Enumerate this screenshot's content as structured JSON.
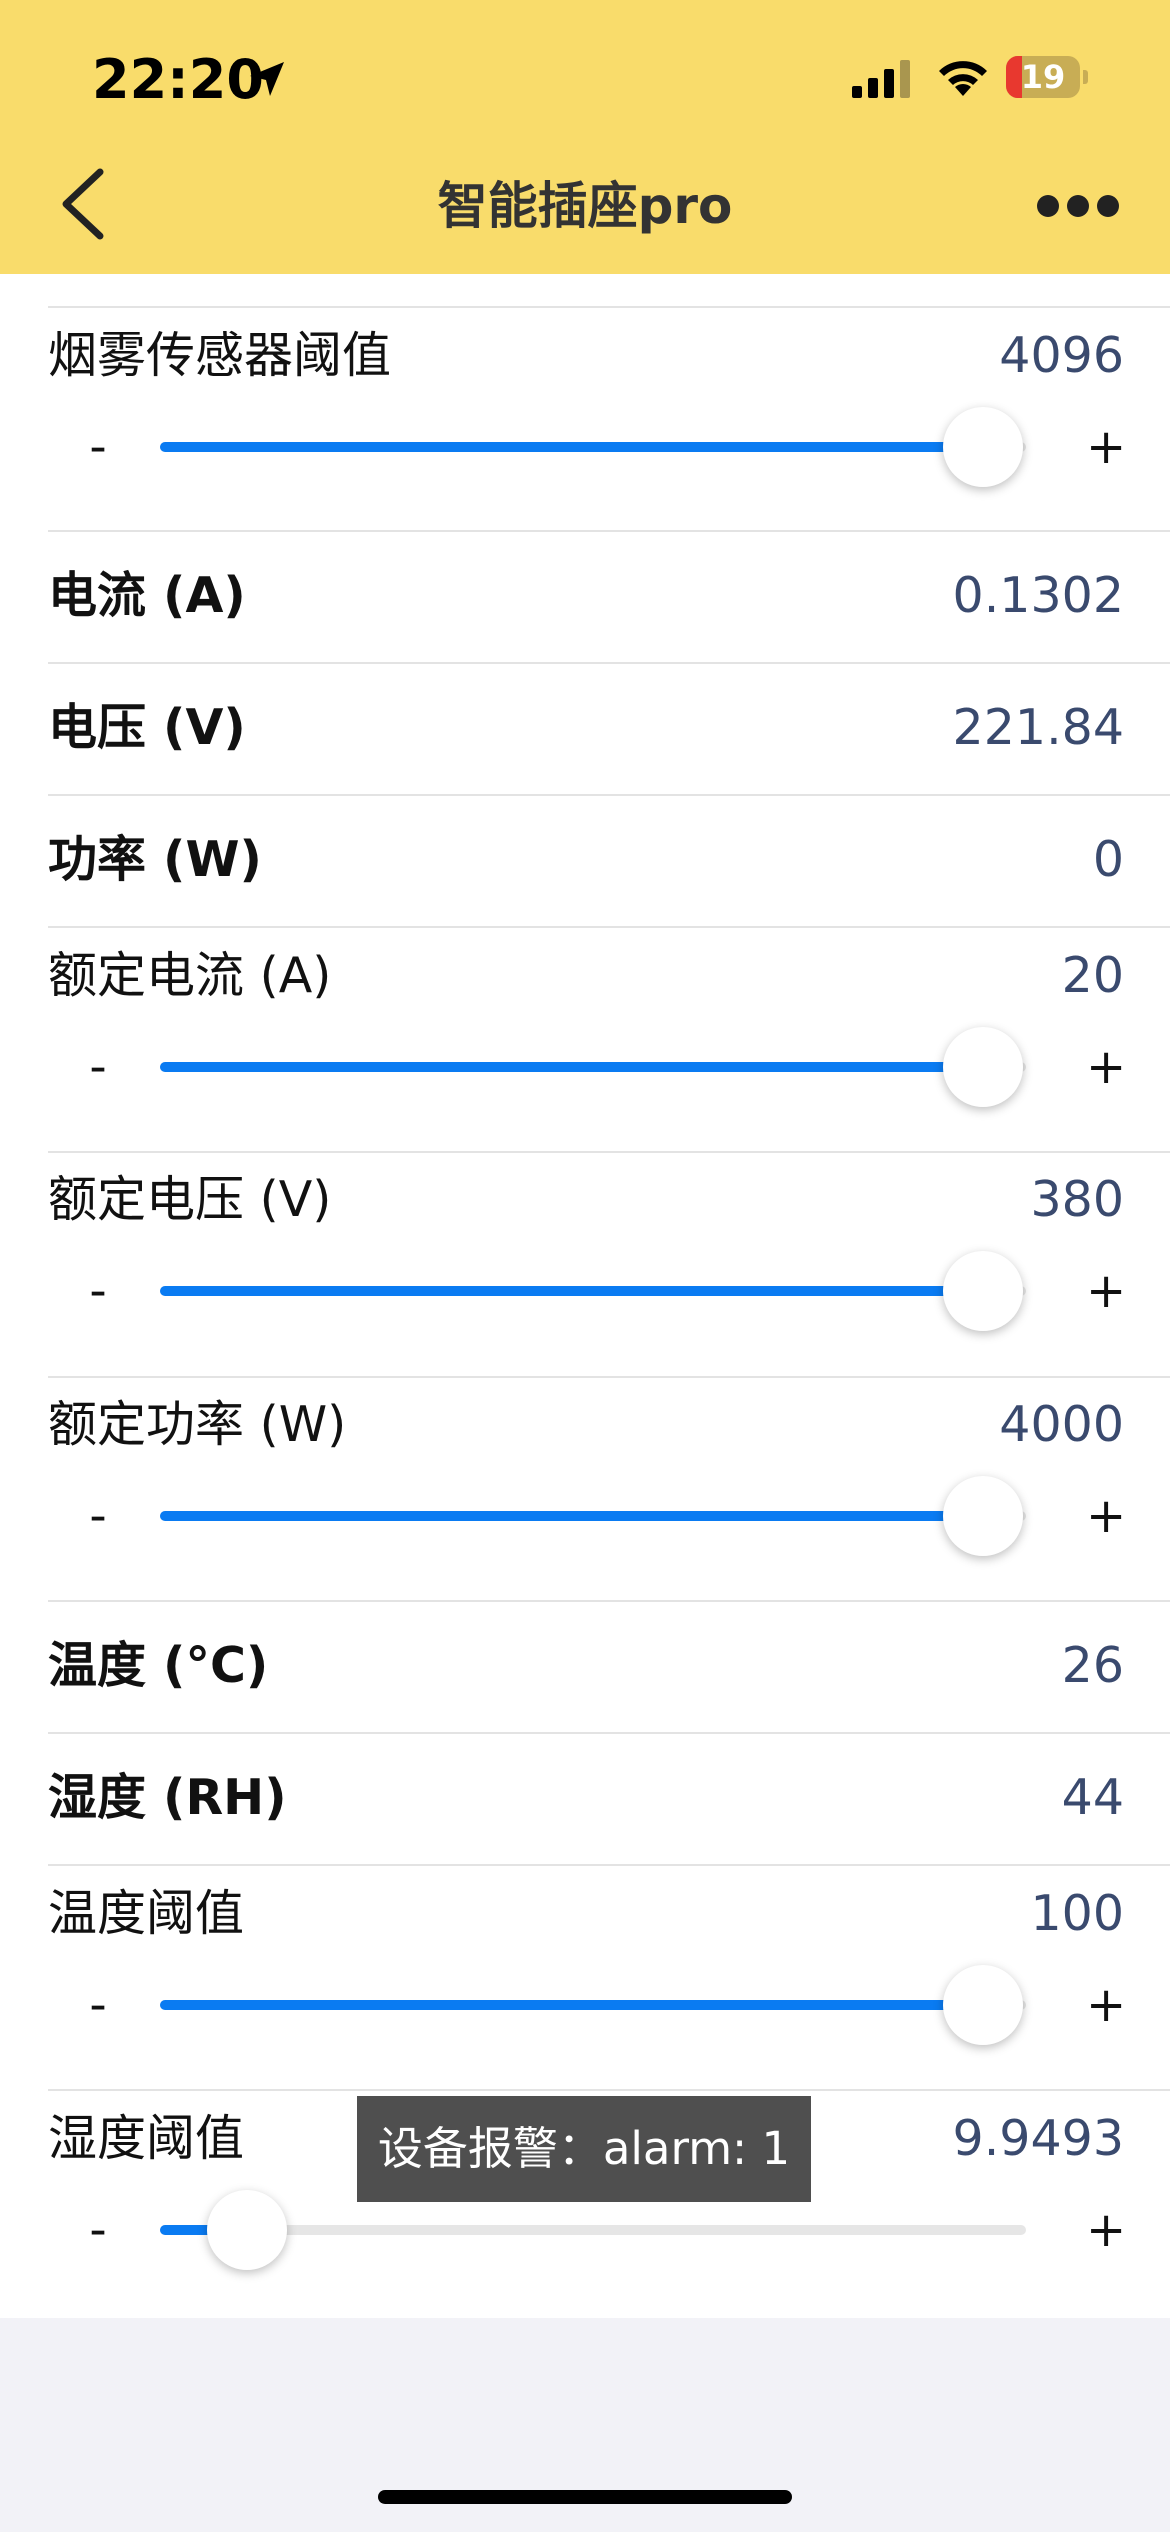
{
  "status_bar": {
    "time": "22:20",
    "battery": "19",
    "icons": [
      "location-arrow-icon",
      "cellular-signal-icon",
      "wifi-icon",
      "battery-icon"
    ]
  },
  "nav": {
    "title": "智能插座pro",
    "back_icon": "chevron-left-icon",
    "more_icon": "more-dots-icon"
  },
  "colors": {
    "header_bg": "#f9dc6b",
    "slider_fill": "#0a7bf2",
    "value_text": "#3a4a6e"
  },
  "rows": [
    {
      "label": "烟雾传感器阈值",
      "value": "4096",
      "slider": true,
      "fraction": 0.95
    },
    {
      "label": "电流 (A)",
      "value": "0.1302"
    },
    {
      "label": "电压 (V)",
      "value": "221.84"
    },
    {
      "label": "功率 (W)",
      "value": "0"
    },
    {
      "label": "额定电流 (A)",
      "value": "20",
      "slider": true,
      "fraction": 0.95
    },
    {
      "label": "额定电压 (V)",
      "value": "380",
      "slider": true,
      "fraction": 0.95
    },
    {
      "label": "额定功率 (W)",
      "value": "4000",
      "slider": true,
      "fraction": 0.95
    },
    {
      "label": "温度 (°C)",
      "value": "26"
    },
    {
      "label": "湿度 (RH)",
      "value": "44"
    },
    {
      "label": "温度阈值",
      "value": "100",
      "slider": true,
      "fraction": 0.95
    },
    {
      "label": "湿度阈值",
      "value": "9.9493",
      "slider": true,
      "fraction": 0.1
    }
  ],
  "slider_controls": {
    "minus": "-",
    "plus": "+"
  },
  "toast": {
    "text": "设备报警：alarm: 1"
  }
}
